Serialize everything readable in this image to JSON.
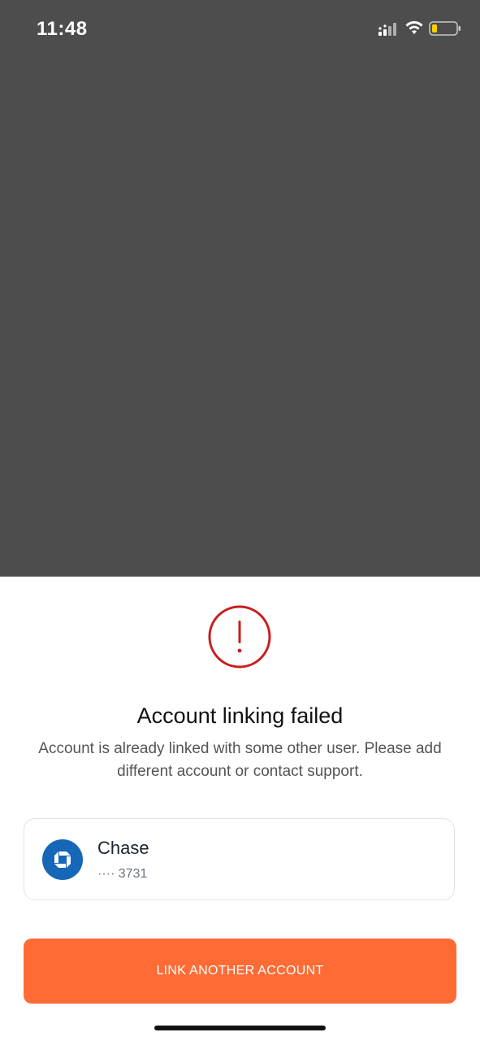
{
  "status_bar": {
    "time": "11:48",
    "icons": [
      "signal-icon",
      "wifi-icon",
      "battery-icon"
    ],
    "battery_color": "#f5d100"
  },
  "sheet": {
    "status_icon": "error-icon",
    "status_color": "#c81e1e",
    "title": "Account linking failed",
    "message": "Account is already linked with some other user. Please add different account or contact support."
  },
  "account": {
    "bank_icon": "chase-logo-icon",
    "bank_color": "#1767b8",
    "bank_name": "Chase",
    "mask": "···· 3731"
  },
  "actions": {
    "primary_label": "LINK ANOTHER ACCOUNT",
    "primary_color": "#ff6b35"
  }
}
